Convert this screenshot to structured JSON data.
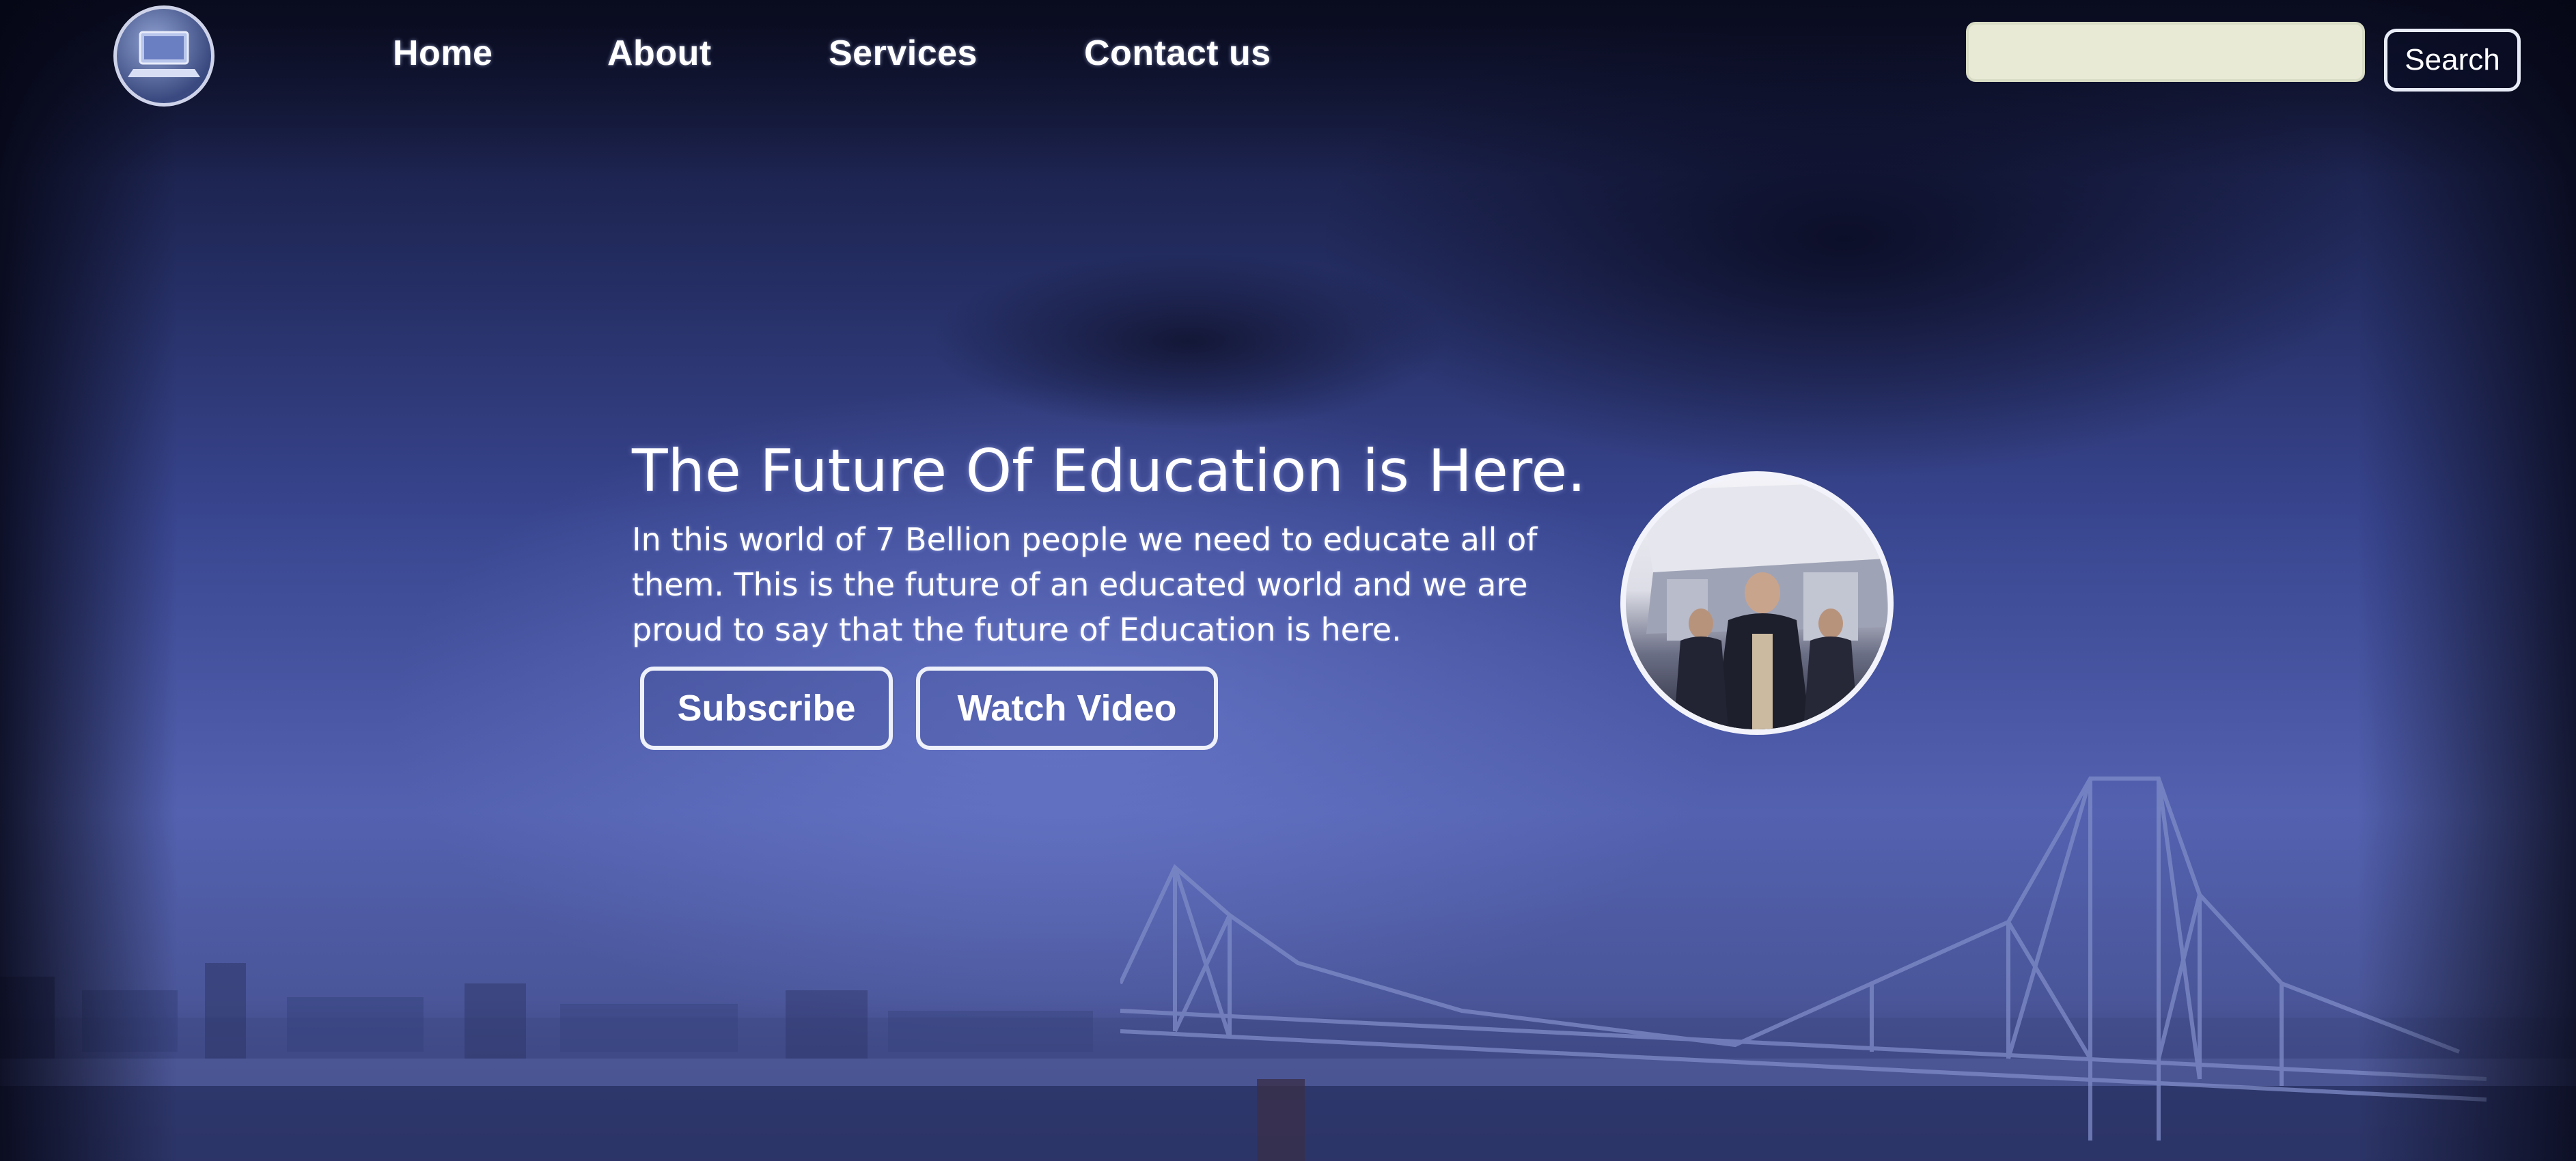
{
  "nav": {
    "links": [
      "Home",
      "About",
      "Services",
      "Contact us"
    ],
    "search_button": "Search",
    "search_value": ""
  },
  "hero": {
    "title": "The Future Of Education is Here.",
    "description": "In this world of 7 Bellion people we need to educate all of them. This is the future of an educated world and we are proud to say that the future of Education is here.",
    "buttons": {
      "subscribe": "Subscribe",
      "watch_video": "Watch Video"
    }
  },
  "colors": {
    "background": "#394690",
    "text": "#ffffff",
    "search_field": "#e9ead6"
  }
}
